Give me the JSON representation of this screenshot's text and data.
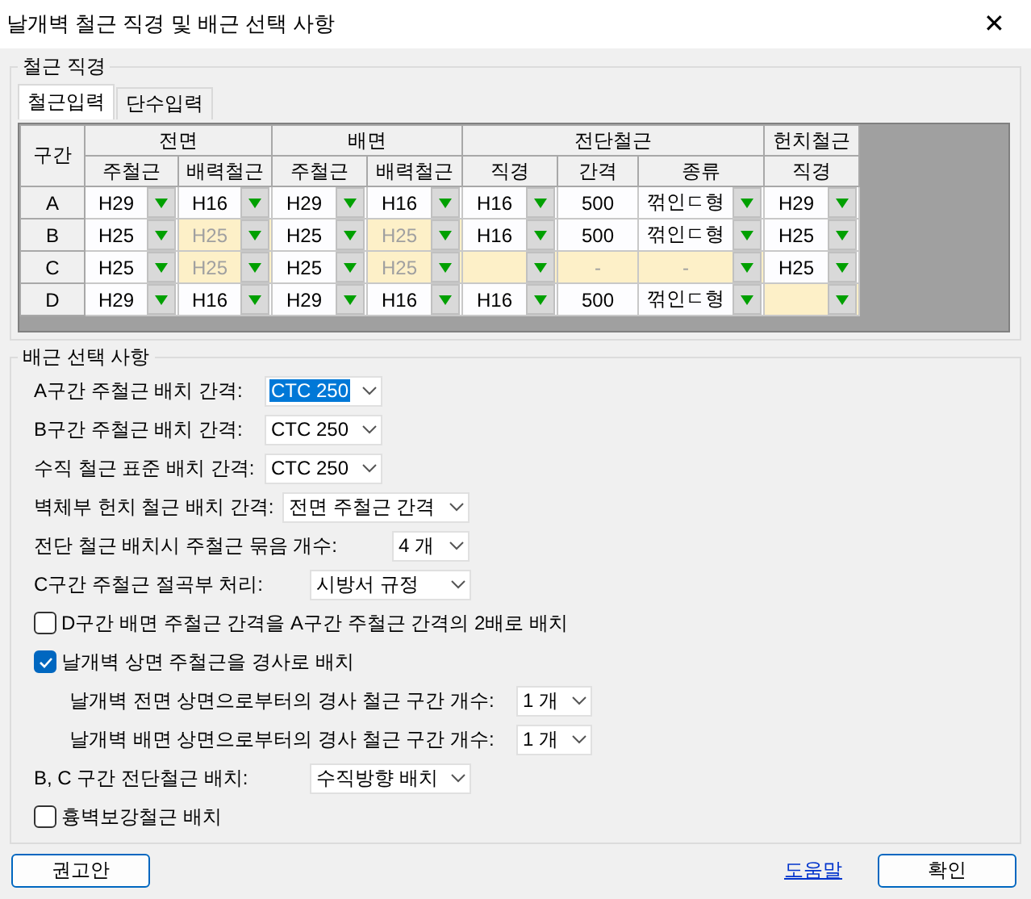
{
  "window": {
    "title": "날개벽 철근 직경 및 배근 선택 사항",
    "close": "✕"
  },
  "diameter_group": {
    "title": "철근 직경",
    "tabs": [
      {
        "label": "철근입력",
        "selected": true
      },
      {
        "label": "단수입력",
        "selected": false
      }
    ],
    "table": {
      "corner": "구간",
      "header_groups": [
        {
          "label": "전면",
          "columns": [
            "주철근",
            "배력철근"
          ]
        },
        {
          "label": "배면",
          "columns": [
            "주철근",
            "배력철근"
          ]
        },
        {
          "label": "전단철근",
          "columns": [
            "직경",
            "간격",
            "종류"
          ]
        },
        {
          "label": "헌치철근",
          "columns": [
            "직경"
          ]
        }
      ],
      "rows": [
        {
          "label": "A",
          "cells": [
            {
              "kind": "combo",
              "value": "H29",
              "highlighted": false,
              "disabled": false
            },
            {
              "kind": "combo",
              "value": "H16",
              "highlighted": false,
              "disabled": false
            },
            {
              "kind": "combo",
              "value": "H29",
              "highlighted": false,
              "disabled": false
            },
            {
              "kind": "combo",
              "value": "H16",
              "highlighted": false,
              "disabled": false
            },
            {
              "kind": "combo",
              "value": "H16",
              "highlighted": false,
              "disabled": false
            },
            {
              "kind": "text",
              "value": "500",
              "highlighted": false,
              "disabled": false
            },
            {
              "kind": "combo",
              "value": "꺾인ㄷ형",
              "highlighted": false,
              "disabled": false
            },
            {
              "kind": "combo",
              "value": "H29",
              "highlighted": false,
              "disabled": false
            }
          ]
        },
        {
          "label": "B",
          "cells": [
            {
              "kind": "combo",
              "value": "H25",
              "highlighted": false,
              "disabled": false
            },
            {
              "kind": "combo",
              "value": "H25",
              "highlighted": true,
              "disabled": true
            },
            {
              "kind": "combo",
              "value": "H25",
              "highlighted": false,
              "disabled": false
            },
            {
              "kind": "combo",
              "value": "H25",
              "highlighted": true,
              "disabled": true
            },
            {
              "kind": "combo",
              "value": "H16",
              "highlighted": false,
              "disabled": false
            },
            {
              "kind": "text",
              "value": "500",
              "highlighted": false,
              "disabled": false
            },
            {
              "kind": "combo",
              "value": "꺾인ㄷ형",
              "highlighted": false,
              "disabled": false
            },
            {
              "kind": "combo",
              "value": "H25",
              "highlighted": false,
              "disabled": false
            }
          ]
        },
        {
          "label": "C",
          "cells": [
            {
              "kind": "combo",
              "value": "H25",
              "highlighted": false,
              "disabled": false
            },
            {
              "kind": "combo",
              "value": "H25",
              "highlighted": true,
              "disabled": true
            },
            {
              "kind": "combo",
              "value": "H25",
              "highlighted": false,
              "disabled": false
            },
            {
              "kind": "combo",
              "value": "H25",
              "highlighted": true,
              "disabled": true
            },
            {
              "kind": "combo",
              "highlighted": true,
              "disabled": false
            },
            {
              "kind": "text",
              "value": "-",
              "highlighted": true,
              "disabled": true
            },
            {
              "kind": "combo",
              "value": "-",
              "highlighted": true,
              "disabled": true
            },
            {
              "kind": "combo",
              "value": "H25",
              "highlighted": false,
              "disabled": false
            }
          ]
        },
        {
          "label": "D",
          "cells": [
            {
              "kind": "combo",
              "value": "H29",
              "highlighted": false,
              "disabled": false
            },
            {
              "kind": "combo",
              "value": "H16",
              "highlighted": false,
              "disabled": false
            },
            {
              "kind": "combo",
              "value": "H29",
              "highlighted": false,
              "disabled": false
            },
            {
              "kind": "combo",
              "value": "H16",
              "highlighted": false,
              "disabled": false
            },
            {
              "kind": "combo",
              "value": "H16",
              "highlighted": false,
              "disabled": false
            },
            {
              "kind": "text",
              "value": "500",
              "highlighted": false,
              "disabled": false
            },
            {
              "kind": "combo",
              "value": "꺾인ㄷ형",
              "highlighted": false,
              "disabled": false
            },
            {
              "kind": "combo",
              "highlighted": true,
              "disabled": false
            }
          ]
        }
      ]
    }
  },
  "options_group": {
    "title": "배근 선택 사항",
    "items": [
      {
        "kind": "select",
        "label": "A구간 주철근 배치 간격:",
        "value": "CTC 250",
        "focused": true
      },
      {
        "kind": "select",
        "label": "B구간 주철근 배치 간격:",
        "value": "CTC 250",
        "focused": false
      },
      {
        "kind": "select",
        "label": "수직 철근 표준 배치 간격:",
        "value": "CTC 250",
        "focused": false
      },
      {
        "kind": "select",
        "label": "벽체부 헌치 철근 배치 간격:",
        "value": "전면 주철근 간격",
        "focused": false
      },
      {
        "kind": "select",
        "label": "전단 철근 배치시 주철근 묶음 개수:",
        "value": "4 개",
        "focused": false
      },
      {
        "kind": "select",
        "label": "C구간 주철근 절곡부 처리:",
        "value": "시방서 규정",
        "focused": false
      },
      {
        "kind": "checkbox",
        "label": "D구간 배면 주철근 간격을 A구간 주철근 간격의 2배로 배치",
        "checked": false
      },
      {
        "kind": "checkbox",
        "label": "날개벽 상면 주철근을 경사로 배치",
        "checked": true,
        "children": [
          {
            "kind": "select",
            "label": "날개벽 전면 상면으로부터의 경사 철근 구간 개수:",
            "value": "1 개",
            "focused": false
          },
          {
            "kind": "select",
            "label": "날개벽 배면 상면으로부터의 경사 철근 구간 개수:",
            "value": "1 개",
            "focused": false
          }
        ]
      },
      {
        "kind": "select",
        "label": "B, C 구간 전단철근 배치:",
        "value": "수직방향 배치",
        "focused": false
      },
      {
        "kind": "checkbox",
        "label": "흉벽보강철근 배치",
        "checked": false
      }
    ]
  },
  "footer": {
    "recommend_button": "권고안",
    "help_link": "도움말",
    "ok_button": "확인"
  }
}
